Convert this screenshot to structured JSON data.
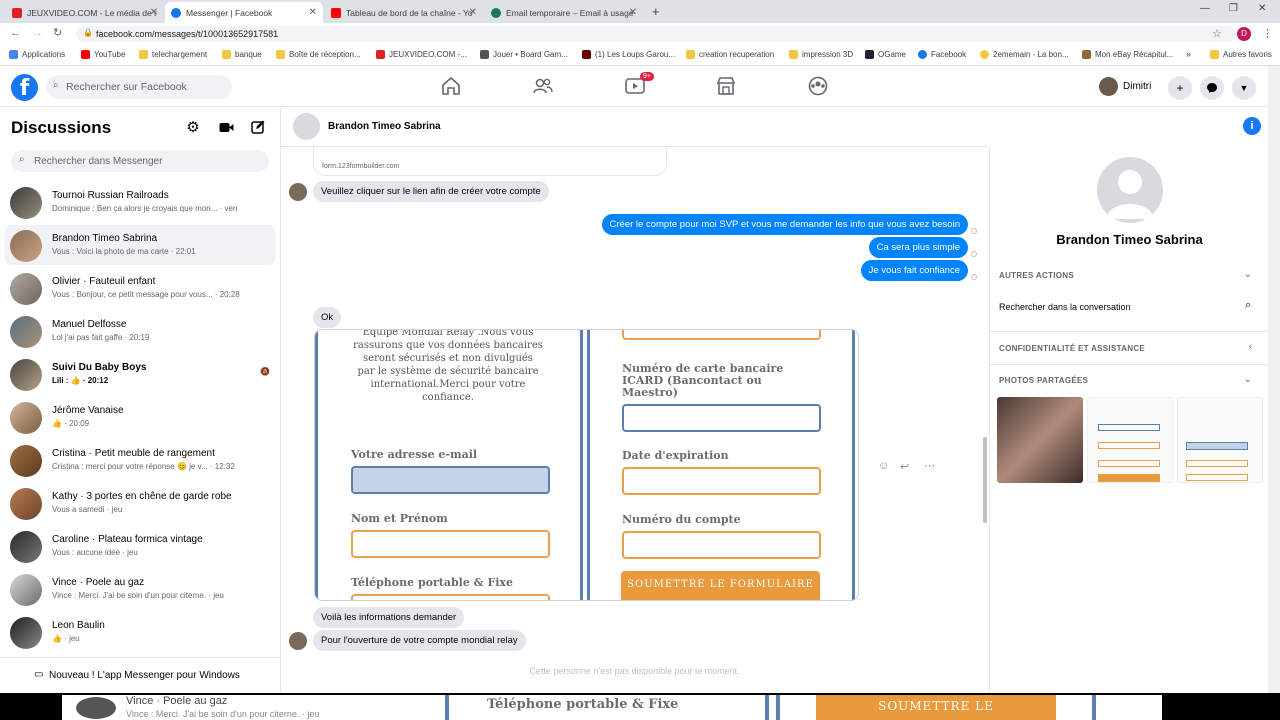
{
  "browser": {
    "tabs": [
      {
        "label": "JEUXVIDEO.COM - Le média de r",
        "active": false
      },
      {
        "label": "Messenger | Facebook",
        "active": true
      },
      {
        "label": "Tableau de bord de la chaîne - Yo",
        "active": false
      },
      {
        "label": "Email temporaire – Email à usage",
        "active": false
      }
    ],
    "new_tab": "+",
    "url": "facebook.com/messages/t/100013652917581",
    "profile_letter": "D",
    "bookmarks": [
      "Applications",
      "YouTube",
      "telechargement",
      "banque",
      "Boîte de réception...",
      "JEUXVIDEO.COM -...",
      "Jouer • Board Gam...",
      "(1) Les Loups Garou...",
      "creation recuperation",
      "impression 3D",
      "OGame",
      "Facebook",
      "2ememain - La bon...",
      "Mon eBay Récapitul...",
      "Autres favoris"
    ]
  },
  "fb": {
    "search_placeholder": "Rechercher sur Facebook",
    "badge": "9+",
    "username": "Dimitri"
  },
  "sidebar": {
    "title": "Discussions",
    "search_placeholder": "Rechercher dans Messenger",
    "conversations": [
      {
        "name": "Tournoi Russian Railroads",
        "preview": "Dominique : Ben ça alors je croyais que mon... · ven"
      },
      {
        "name": "Brandon Timeo Sabrina",
        "preview": "Vous : Voici la photo de ma carte · 22:01"
      },
      {
        "name": "Olivier · Fauteuil enfant",
        "preview": "Vous : Bonjour, ce petit message pour vous... · 20:28"
      },
      {
        "name": "Manuel Delfosse",
        "preview": "Lol j'ai pas fait gaffe · 20:19"
      },
      {
        "name": "Suivi Du Baby Boys",
        "preview": "Lili : 👍 · 20:12"
      },
      {
        "name": "Jérôme Vanaise",
        "preview": "👍 · 20:09"
      },
      {
        "name": "Cristina · Petit meuble de rangement",
        "preview": "Cristina : merci pour votre réponse 😊 je v... · 12:32"
      },
      {
        "name": "Kathy · 3 portes en chêne de garde robe",
        "preview": "Vous a samedi · jeu"
      },
      {
        "name": "Caroline · Plateau formica vintage",
        "preview": "Vous : aucune idée · jeu"
      },
      {
        "name": "Vince · Poele au gaz",
        "preview": "Vince : Merci. J'ai be soin d'un pour citerne. · jeu"
      },
      {
        "name": "Leon Baulin",
        "preview": "👍 · jeu"
      }
    ],
    "windows_app": "Nouveau ! L'app Messenger pour Windows"
  },
  "conversation": {
    "name": "Brandon Timeo Sabrina",
    "link_domain": "form.123formbuilder.com",
    "messages": [
      {
        "dir": "in",
        "text": "Veuillez cliquer sur le lien afin de créer votre compte"
      },
      {
        "dir": "out",
        "text": "Créer le compte pour moi SVP et vous me demander les info que vous avez besoin"
      },
      {
        "dir": "out",
        "text": "Ca sera plus simple"
      },
      {
        "dir": "out",
        "text": "Je vous fait confiance"
      },
      {
        "dir": "in",
        "text": "Ok"
      },
      {
        "dir": "in",
        "text": "Voilà les informations demander"
      },
      {
        "dir": "in",
        "text": "Pour l'ouverture de votre compte mondial relay"
      }
    ],
    "form_image": {
      "intro": "Équipe Mondial Relay .Nous vous rassurons que vos données bancaires seront sécurisés et non divulgués par le système de sécurité bancaire international.Merci pour votre confiance.",
      "email_label": "Votre adresse e-mail",
      "name_label": "Nom et Prénom",
      "phone_label": "Téléphone portable & Fixe",
      "card_label": "Numéro de carte bancaire ICARD (Bancontact ou Maestro)",
      "expiry_label": "Date d'expiration",
      "account_label": "Numéro du compte",
      "submit_label": "SOUMETTRE LE FORMULAIRE"
    },
    "unavailable_note": "Cette personne n'est pas disponible pour le moment."
  },
  "right_panel": {
    "name": "Brandon Timeo Sabrina",
    "more_actions": "AUTRES ACTIONS",
    "search_conv": "Rechercher dans la conversation",
    "privacy": "CONFIDENTIALITÉ ET ASSISTANCE",
    "shared_photos": "PHOTOS PARTAGÉES"
  },
  "bleed": {
    "vince_name": "Vince · Poele au gaz",
    "vince_preview": "Vince : Merci. J'ai be soin d'un pour citerne. · jeu",
    "phone_label": "Téléphone portable & Fixe",
    "submit_label": "SOUMETTRE LE"
  },
  "colors": {
    "accent": "#1877f2",
    "bubble_out": "#0084ff",
    "form_orange": "#e8a14b",
    "form_blue": "#5a7fb0"
  }
}
